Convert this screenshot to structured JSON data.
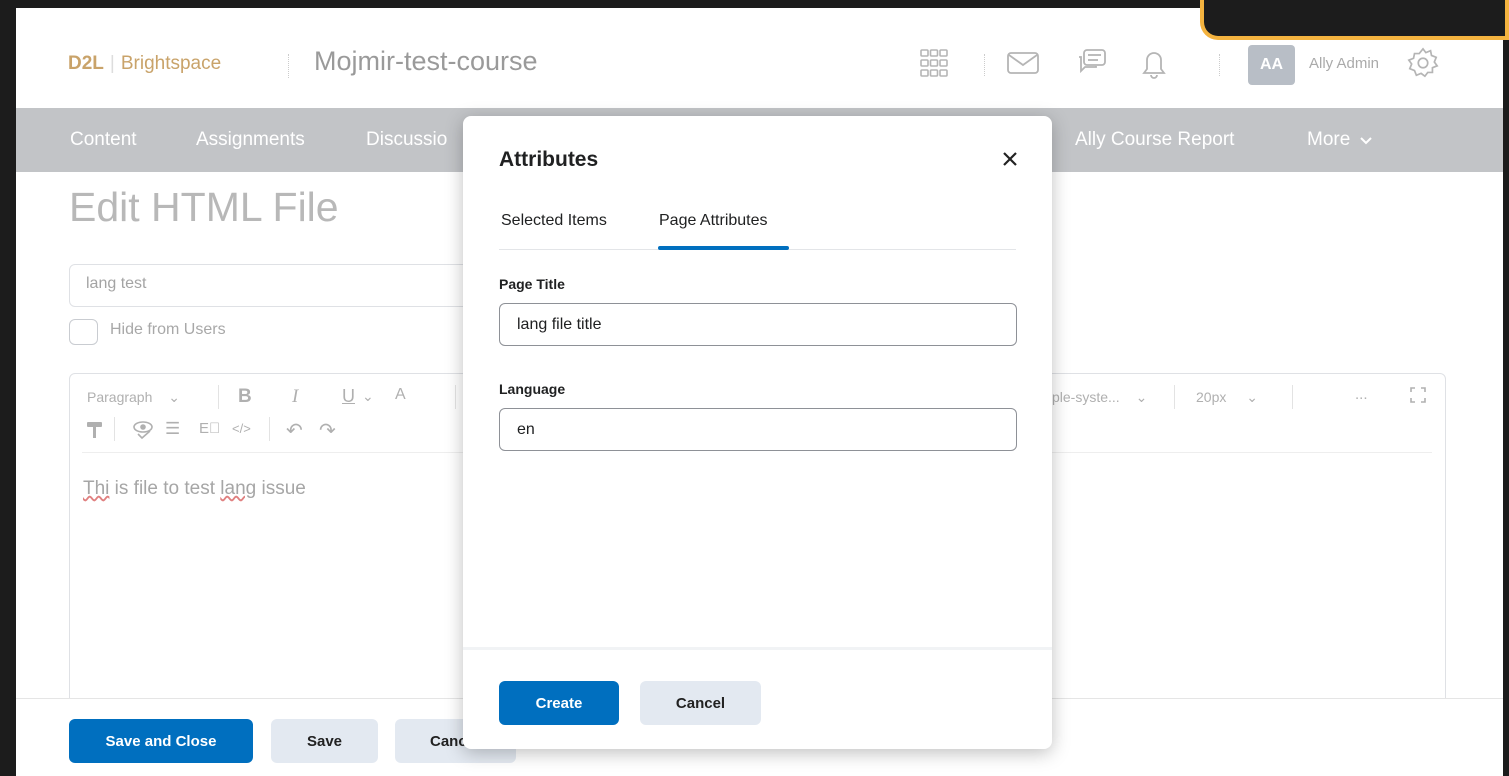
{
  "header": {
    "logo_brand": "D2L",
    "logo_product": "Brightspace",
    "course_name": "Mojmir-test-course",
    "avatar_initials": "AA",
    "user_name": "Ally Admin"
  },
  "nav": {
    "items": [
      "Content",
      "Assignments",
      "Discussio",
      "Ally Course Report",
      "More"
    ]
  },
  "page": {
    "title": "Edit HTML File",
    "file_title_value": "lang test",
    "hide_from_users_label": "Hide from Users"
  },
  "editor": {
    "toolbar": {
      "format": "Paragraph",
      "font_family": "ple-syste...",
      "font_size": "20px",
      "more": "..."
    },
    "content": {
      "word1": "Thi",
      "middle": " is file to test ",
      "word2": "lang",
      "end": " issue"
    }
  },
  "footer": {
    "save_close_label": "Save and Close",
    "save_label": "Save",
    "cancel_label": "Canc"
  },
  "dialog": {
    "title": "Attributes",
    "tabs": [
      "Selected Items",
      "Page Attributes"
    ],
    "active_tab": "Page Attributes",
    "page_title_label": "Page Title",
    "page_title_value": "lang file title",
    "language_label": "Language",
    "language_value": "en",
    "create_label": "Create",
    "cancel_label": "Cancel"
  },
  "colors": {
    "primary": "#006fbf",
    "nav_bg": "#c2c4c7",
    "secondary_button": "#e3e9f1",
    "highlight_border": "#f4b33f"
  }
}
